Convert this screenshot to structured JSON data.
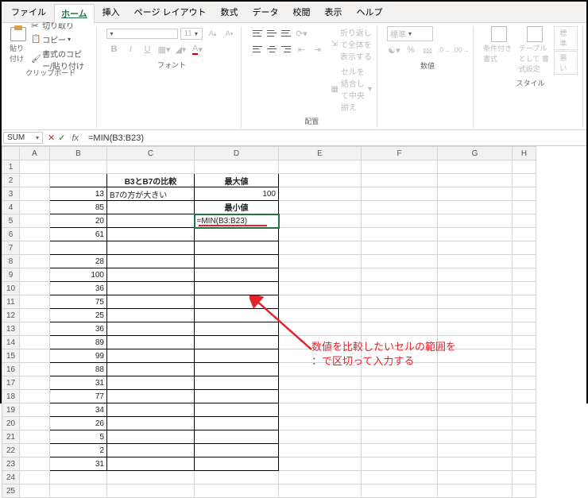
{
  "tabs": {
    "file": "ファイル",
    "home": "ホーム",
    "insert": "挿入",
    "layout": "ページ レイアウト",
    "formulas": "数式",
    "data": "データ",
    "review": "校閲",
    "view": "表示",
    "help": "ヘルプ"
  },
  "clipboard": {
    "cut": "切り取り",
    "copy": "コピー",
    "paste_label": "貼り付け",
    "format_painter": "書式のコピー/貼り付け",
    "group_label": "クリップボード"
  },
  "font": {
    "size": "11",
    "bold": "B",
    "italic": "I",
    "underline": "U",
    "group_label": "フォント"
  },
  "align": {
    "wrap": "折り返して全体を表示する",
    "merge": "セルを結合して中央揃え",
    "group_label": "配置"
  },
  "number": {
    "format": "標準",
    "group_label": "数値"
  },
  "styles": {
    "cond": "条件付き\n書式",
    "table": "テーブルとして\n書式設定",
    "normal": "標準",
    "bad": "悪い",
    "group_label": "スタイル"
  },
  "name_box": "SUM",
  "formula": "=MIN(B3:B23)",
  "headers": {
    "cmp": "B3とB7の比較",
    "max": "最大値",
    "min": "最小値"
  },
  "cells": {
    "B3": "13",
    "C3": "B7の方が大きい",
    "D3": "100",
    "B4": "85",
    "B5": "20",
    "D5": "=MIN(B3:B23)",
    "B6": "61",
    "B8": "28",
    "B9": "100",
    "B10": "36",
    "B11": "75",
    "B12": "25",
    "B13": "36",
    "B14": "89",
    "B15": "99",
    "B16": "88",
    "B17": "31",
    "B18": "77",
    "B19": "34",
    "B20": "26",
    "B21": "5",
    "B22": "2",
    "B23": "31"
  },
  "annotation": {
    "line1": "数値を比較したいセルの範囲を",
    "line2": "：で区切って入力する"
  },
  "chart_data": {
    "type": "table",
    "title": "Excel MIN function example",
    "columns": [
      "B",
      "C",
      "D"
    ],
    "rows": [
      {
        "row": 2,
        "B": "",
        "C": "B3とB7の比較",
        "D": "最大値"
      },
      {
        "row": 3,
        "B": 13,
        "C": "B7の方が大きい",
        "D": 100
      },
      {
        "row": 4,
        "B": 85,
        "C": "",
        "D": "最小値"
      },
      {
        "row": 5,
        "B": 20,
        "C": "",
        "D": "=MIN(B3:B23)"
      },
      {
        "row": 6,
        "B": 61
      },
      {
        "row": 7,
        "B": null
      },
      {
        "row": 8,
        "B": 28
      },
      {
        "row": 9,
        "B": 100
      },
      {
        "row": 10,
        "B": 36
      },
      {
        "row": 11,
        "B": 75
      },
      {
        "row": 12,
        "B": 25
      },
      {
        "row": 13,
        "B": 36
      },
      {
        "row": 14,
        "B": 89
      },
      {
        "row": 15,
        "B": 99
      },
      {
        "row": 16,
        "B": 88
      },
      {
        "row": 17,
        "B": 31
      },
      {
        "row": 18,
        "B": 77
      },
      {
        "row": 19,
        "B": 34
      },
      {
        "row": 20,
        "B": 26
      },
      {
        "row": 21,
        "B": 5
      },
      {
        "row": 22,
        "B": 2
      },
      {
        "row": 23,
        "B": 31
      }
    ]
  }
}
